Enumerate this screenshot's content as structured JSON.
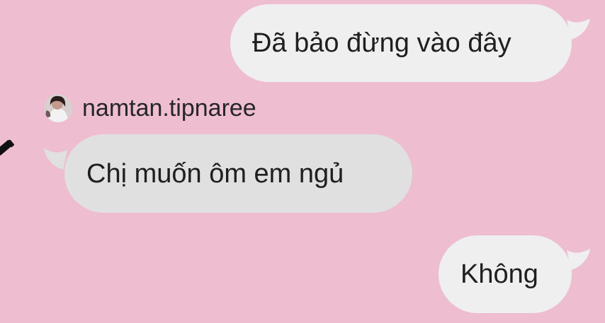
{
  "conversation": {
    "messages": [
      {
        "direction": "outgoing",
        "text": "Đã bảo đừng vào đây"
      },
      {
        "direction": "incoming",
        "sender": "namtan.tipnaree",
        "text": "Chị muốn ôm em ngủ"
      },
      {
        "direction": "outgoing",
        "text": "Không"
      }
    ]
  },
  "icons": {
    "avatar": "profile-photo",
    "edge": "pencil-icon"
  },
  "colors": {
    "background": "#efbdd0",
    "outgoing_bubble": "#efefef",
    "incoming_bubble": "#e0e0e0",
    "text": "#1f1f1f"
  }
}
